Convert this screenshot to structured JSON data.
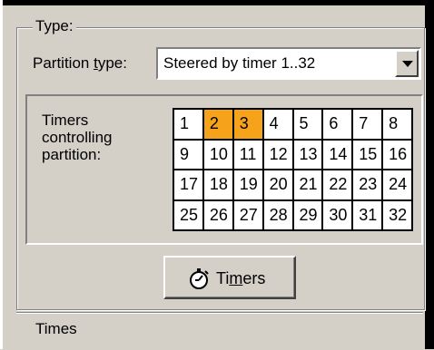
{
  "type_group": {
    "legend": "Type:",
    "partition_type_label_pre": "Partition ",
    "partition_type_label_u": "t",
    "partition_type_label_post": "ype:",
    "partition_type_value": "Steered by timer 1..32"
  },
  "timers_label": [
    "Timers",
    "controlling",
    "partition:"
  ],
  "timers": {
    "cells": [
      "1",
      "2",
      "3",
      "4",
      "5",
      "6",
      "7",
      "8",
      "9",
      "10",
      "11",
      "12",
      "13",
      "14",
      "15",
      "16",
      "17",
      "18",
      "19",
      "20",
      "21",
      "22",
      "23",
      "24",
      "25",
      "26",
      "27",
      "28",
      "29",
      "30",
      "31",
      "32"
    ],
    "selected": [
      "2",
      "3"
    ],
    "selected_color": "#f7a21b"
  },
  "timers_button": {
    "label_pre": "Ti",
    "label_u": "m",
    "label_post": "ers",
    "icon": "stopwatch-icon"
  },
  "times_group": {
    "legend": "Times"
  }
}
